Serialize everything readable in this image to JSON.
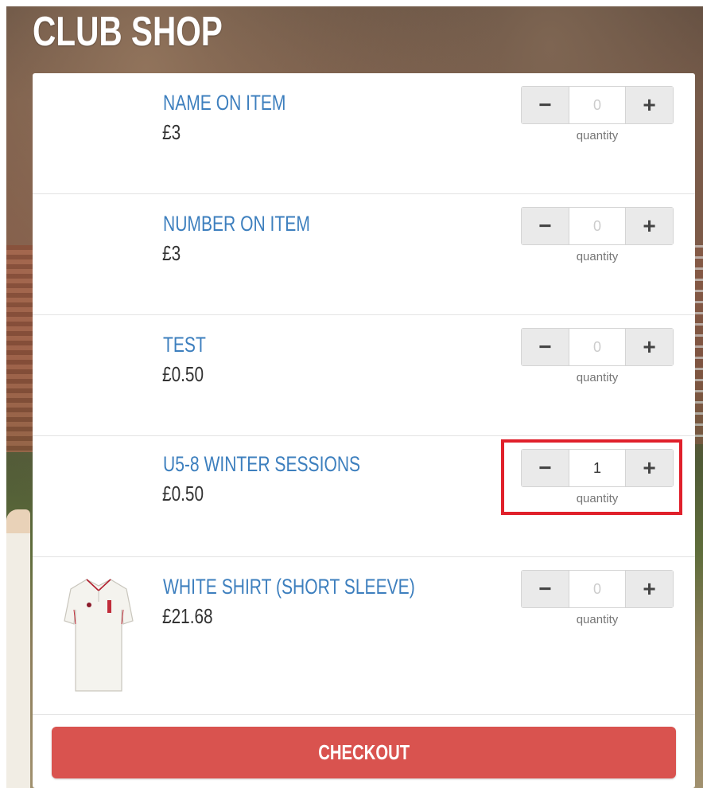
{
  "header": {
    "title": "CLUB SHOP"
  },
  "items": [
    {
      "name": "NAME ON ITEM",
      "price": "£3",
      "quantity": "0",
      "quantity_label": "quantity",
      "minus": "−",
      "plus": "+"
    },
    {
      "name": "NUMBER ON ITEM",
      "price": "£3",
      "quantity": "0",
      "quantity_label": "quantity",
      "minus": "−",
      "plus": "+"
    },
    {
      "name": "TEST",
      "price": "£0.50",
      "quantity": "0",
      "quantity_label": "quantity",
      "minus": "−",
      "plus": "+"
    },
    {
      "name": "U5-8 WINTER SESSIONS",
      "price": "£0.50",
      "quantity": "1",
      "quantity_label": "quantity",
      "minus": "−",
      "plus": "+"
    },
    {
      "name": "WHITE SHIRT (SHORT SLEEVE)",
      "price": "£21.68",
      "quantity": "0",
      "quantity_label": "quantity",
      "minus": "−",
      "plus": "+"
    }
  ],
  "checkout": {
    "label": "CHECKOUT"
  },
  "colors": {
    "link": "#3d7fbe",
    "checkout": "#d9534f",
    "highlight": "#e0202b"
  },
  "icons": {
    "shirt": "white-shirt-product-image"
  }
}
